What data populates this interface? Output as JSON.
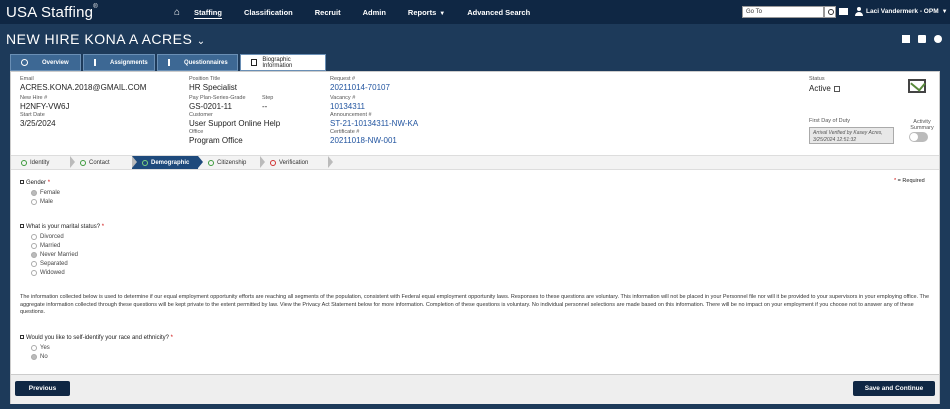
{
  "brand": "USA Staffing",
  "brand_mark": "®",
  "nav": {
    "items": [
      {
        "label": "Staffing"
      },
      {
        "label": "Classification"
      },
      {
        "label": "Recruit"
      },
      {
        "label": "Admin"
      },
      {
        "label": "Reports"
      },
      {
        "label": "Advanced Search"
      }
    ],
    "goto_placeholder": "Go To",
    "user": "Laci Vandermerk - OPM"
  },
  "title": "NEW HIRE KONA A ACRES",
  "tabs": [
    {
      "label": "Overview"
    },
    {
      "label": "Assignments"
    },
    {
      "label": "Questionnaires"
    },
    {
      "label": "Biographic Information"
    }
  ],
  "info": {
    "email_label": "Email",
    "email": "ACRES.KONA.2018@GMAIL.COM",
    "newhire_label": "New Hire #",
    "newhire": "H2NFY-VW6J",
    "start_label": "Start Date",
    "start": "3/25/2024",
    "position_label": "Position Title",
    "position": "HR Specialist",
    "ppsg_label": "Pay Plan-Series-Grade",
    "ppsg": "GS-0201-11",
    "step_label": "Step",
    "step": "--",
    "customer_label": "Customer",
    "customer": "User Support Online Help",
    "office_label": "Office",
    "office": "Program Office",
    "request_label": "Request #",
    "request": "20211014-70107",
    "vacancy_label": "Vacancy #",
    "vacancy": "10134311",
    "announcement_label": "Announcement #",
    "announcement": "ST-21-10134311-NW-KA",
    "certificate_label": "Certificate #",
    "certificate": "20211018-NW-001",
    "status_label": "Status",
    "status": "Active",
    "fdd_label": "First Day of Duty",
    "fdd_note": "Arrival Verified by Kasey Acres, 3/25/2024 12:51:32",
    "activity_label": "Activity Summary"
  },
  "steps": [
    {
      "label": "Identity"
    },
    {
      "label": "Contact"
    },
    {
      "label": "Demographic"
    },
    {
      "label": "Citizenship"
    },
    {
      "label": "Verification"
    }
  ],
  "form": {
    "required_note": "= Required",
    "gender_label": "Gender",
    "gender_options": [
      "Female",
      "Male"
    ],
    "marital_label": "What is your marital status?",
    "marital_options": [
      "Divorced",
      "Married",
      "Never Married",
      "Separated",
      "Widowed"
    ],
    "paragraph": "The information collected below is used to determine if our equal employment opportunity efforts are reaching all segments of the population, consistent with Federal equal employment opportunity laws. Responses to these questions are voluntary. This information will not be placed in your Personnel file nor will it be provided to your supervisors in your employing office. The aggregate information collected through these questions will be kept private to the extent permitted by law. View the Privacy Act Statement below for more information. Completion of these questions is voluntary. No individual personnel selections are made based on this information. There will be no impact on your employment if you choose not to answer any of these questions.",
    "race_label": "Would you like to self-identify your race and ethnicity?",
    "race_options": [
      "Yes",
      "No"
    ]
  },
  "buttons": {
    "previous": "Previous",
    "save": "Save and Continue"
  }
}
